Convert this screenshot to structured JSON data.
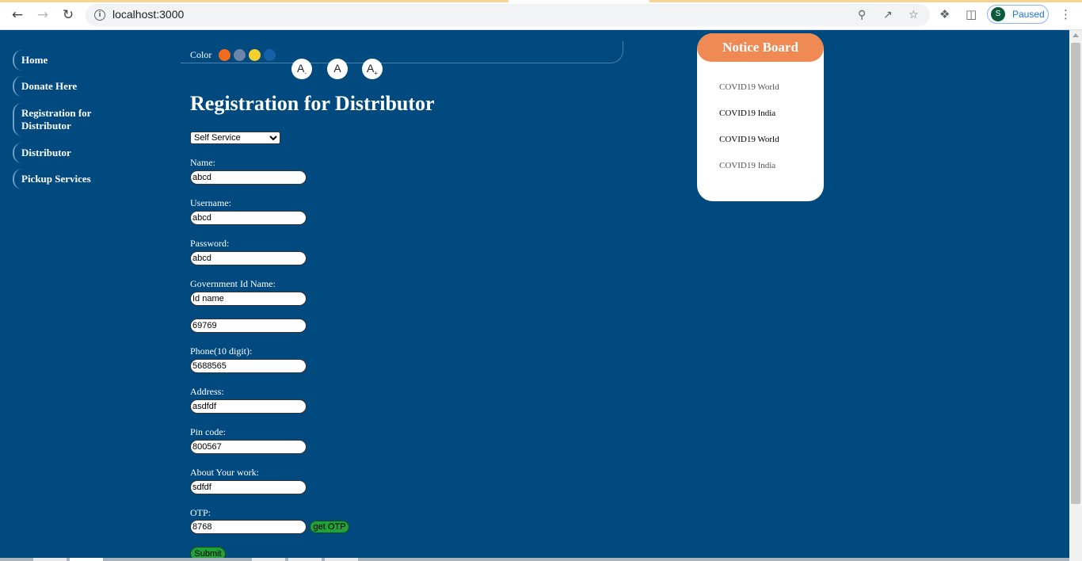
{
  "browser": {
    "url": "localhost:3000",
    "profile_initial": "S",
    "profile_status": "Paused"
  },
  "sidebar": {
    "items": [
      {
        "label": "Home"
      },
      {
        "label": "Donate Here"
      },
      {
        "label": "Registration for Distributor"
      },
      {
        "label": "Distributor"
      },
      {
        "label": "Pickup Services"
      }
    ]
  },
  "toolbar": {
    "color_label": "Color",
    "swatches": [
      "#f26c1b",
      "#6b86a8",
      "#f5cf2b",
      "#1660a8"
    ],
    "font_decrease": "A",
    "font_decrease_sub": "-",
    "font_reset": "A",
    "font_increase": "A",
    "font_increase_sub": "+"
  },
  "form": {
    "title": "Registration for Distributor",
    "service_select": "Self Service",
    "name_label": "Name:",
    "name_value": "abcd",
    "username_label": "Username:",
    "username_value": "abcd",
    "password_label": "Password:",
    "password_value": "abcd",
    "gov_id_label": "Government Id Name:",
    "gov_id_value": "Id name",
    "gov_id_number_value": "69769",
    "phone_label": "Phone(10 digit):",
    "phone_value": "5688565",
    "address_label": "Address:",
    "address_value": "asdfdf",
    "pincode_label": "Pin code:",
    "pincode_value": "800567",
    "about_label": "About Your work:",
    "about_value": "sdfdf",
    "otp_label": "OTP:",
    "otp_value": "8768",
    "get_otp_label": "get OTP",
    "submit_label": "Submit"
  },
  "notice_board": {
    "title": "Notice Board",
    "items": [
      "COVID19 World",
      "COVID19 India",
      "COVID19 World",
      "COVID19 India"
    ]
  },
  "colors": {
    "page_bg": "#004a80",
    "notice_header": "#f08a54",
    "button_green": "#22a03a"
  }
}
